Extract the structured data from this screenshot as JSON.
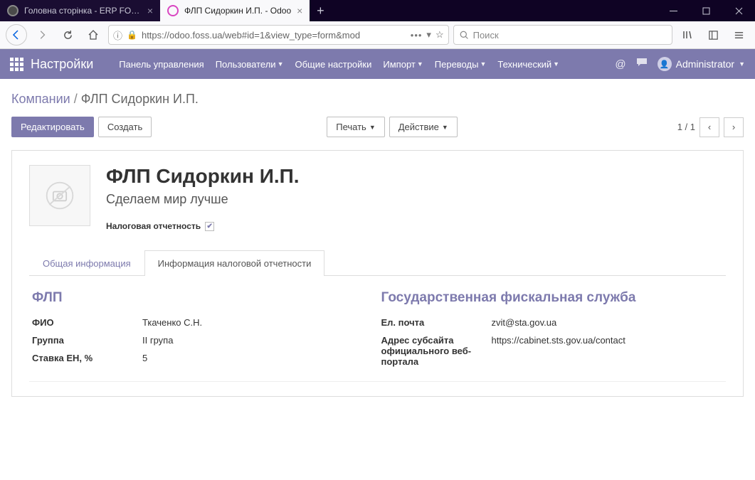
{
  "browser": {
    "tabs": [
      {
        "label": "Головна сторінка - ERP FOSS"
      },
      {
        "label": "ФЛП Сидоркин И.П. - Odoo"
      }
    ],
    "url": "https://odoo.foss.ua/web#id=1&view_type=form&mod",
    "search_placeholder": "Поиск"
  },
  "app": {
    "title": "Настройки",
    "menu": [
      "Панель управления",
      "Пользователи",
      "Общие настройки",
      "Импорт",
      "Переводы",
      "Технический"
    ],
    "menu_dropdown": [
      false,
      true,
      false,
      true,
      true,
      true
    ],
    "user": "Administrator"
  },
  "breadcrumbs": {
    "root": "Компании",
    "current": "ФЛП Сидоркин И.П."
  },
  "buttons": {
    "edit": "Редактировать",
    "create": "Создать",
    "print": "Печать",
    "action": "Действие"
  },
  "pager": {
    "current": "1",
    "total": "1"
  },
  "record": {
    "name": "ФЛП Сидоркин И.П.",
    "tagline": "Сделаем мир лучше",
    "tax_report_label": "Налоговая отчетность"
  },
  "tabs": {
    "general": "Общая информация",
    "tax": "Информация налоговой отчетности"
  },
  "flp": {
    "heading": "ФЛП",
    "fio_label": "ФИО",
    "fio_value": "Ткаченко С.Н.",
    "group_label": "Группа",
    "group_value": "II група",
    "rate_label": "Ставка ЕН, %",
    "rate_value": "5"
  },
  "gfs": {
    "heading": "Государственная фискальная служба",
    "email_label": "Ел. почта",
    "email_value": "zvit@sta.gov.ua",
    "portal_label": "Адрес субсайта официального веб-портала",
    "portal_value": "https://cabinet.sts.gov.ua/contact"
  }
}
